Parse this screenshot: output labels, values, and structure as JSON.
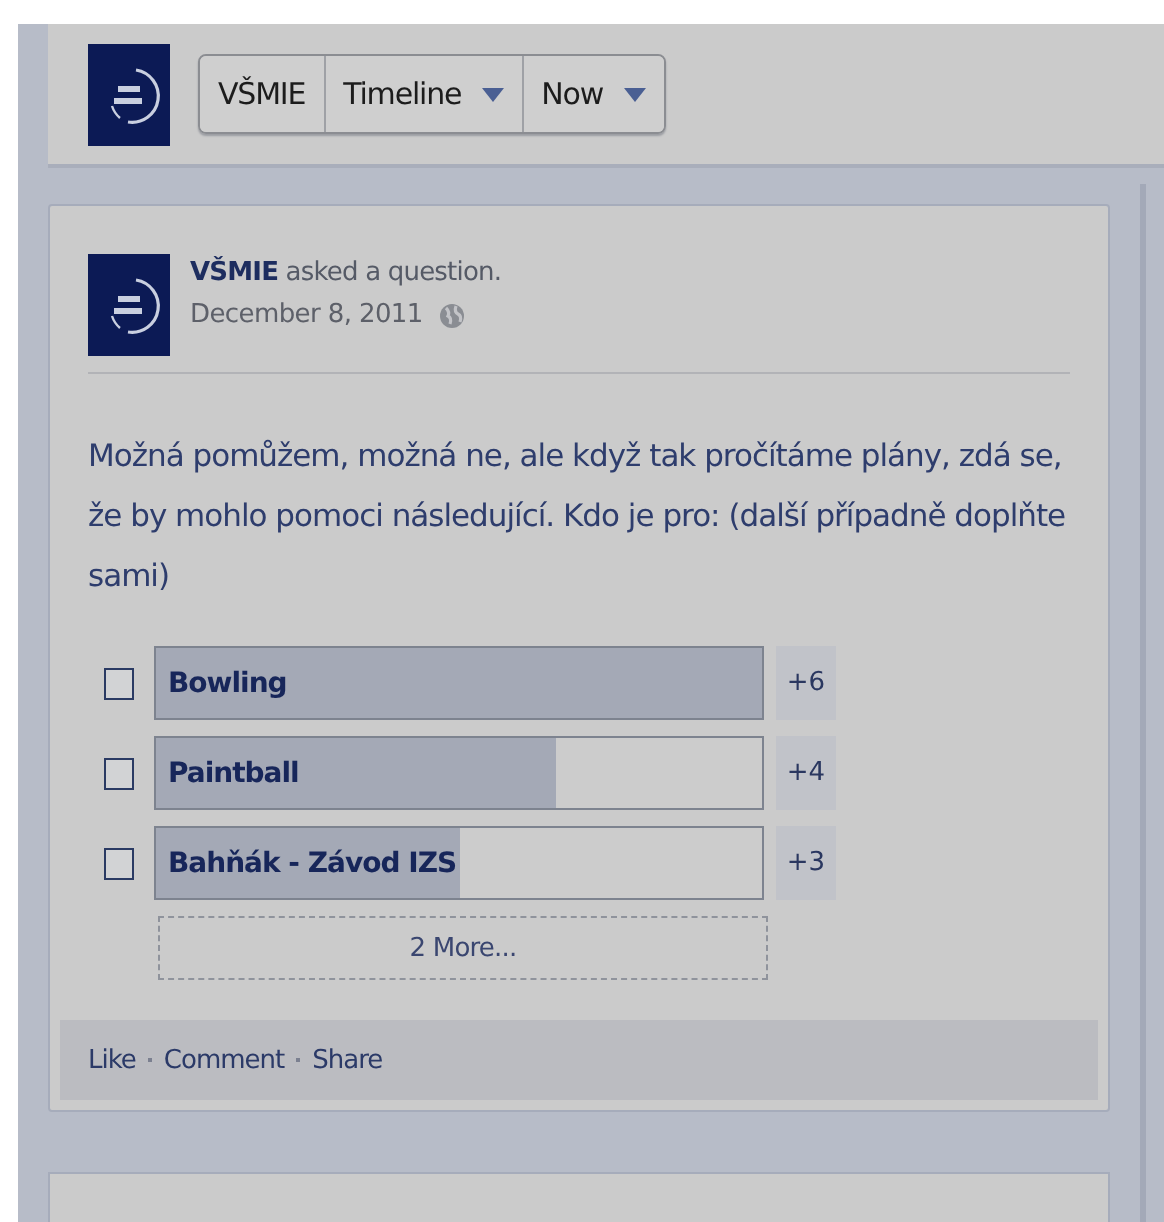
{
  "header": {
    "page_button": "VŠMIE",
    "menus": [
      {
        "label": "Timeline"
      },
      {
        "label": "Now"
      }
    ]
  },
  "post": {
    "author": "VŠMIE",
    "action": "asked a question.",
    "date": "December 8, 2011",
    "question": "Možná pomůžem, možná ne, ale když tak pročítáme plány, zdá se, že by mohlo pomoci následující. Kdo je pro: (další případně doplňte sami)",
    "options": [
      {
        "label": "Bowling",
        "checked": false,
        "level": 1,
        "count": "+6"
      },
      {
        "label": "Paintball",
        "checked": false,
        "level": 0.66,
        "count": "+4"
      },
      {
        "label": "Bahňák - Závod IZS",
        "checked": false,
        "level": 0.5,
        "count": "+3"
      }
    ],
    "more": "2 More...",
    "actions": [
      "Like",
      "Comment",
      "Share"
    ]
  }
}
